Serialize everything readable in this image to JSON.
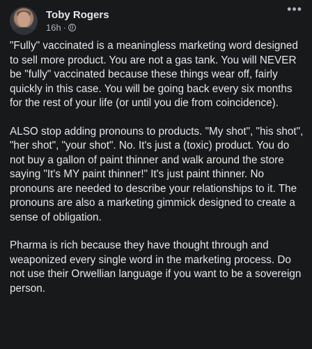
{
  "post": {
    "author": "Toby Rogers",
    "time": "16h",
    "separator": "·",
    "audience_icon": "globe-icon",
    "more_label": "•••",
    "paragraphs": [
      "\"Fully\" vaccinated is a meaningless marketing word designed to sell more product. You are not a gas tank. You will NEVER be \"fully\" vaccinated because these things wear off, fairly quickly in this case. You will be going back every six months for the rest of your life (or until you die from coincidence).",
      "ALSO stop adding pronouns to products. \"My shot\", \"his shot\", \"her shot\", \"your shot\". No. It's just a (toxic) product. You do not buy a gallon of paint thinner and walk around the store saying \"It's MY paint thinner!\" It's just paint thinner. No pronouns are needed to describe your relationships to it. The pronouns are also a marketing gimmick designed to create a sense of obligation.",
      "Pharma is rich because they have thought through and weaponized every single word in the marketing process. Do not use their Orwellian language if you want to be a sovereign person."
    ]
  }
}
